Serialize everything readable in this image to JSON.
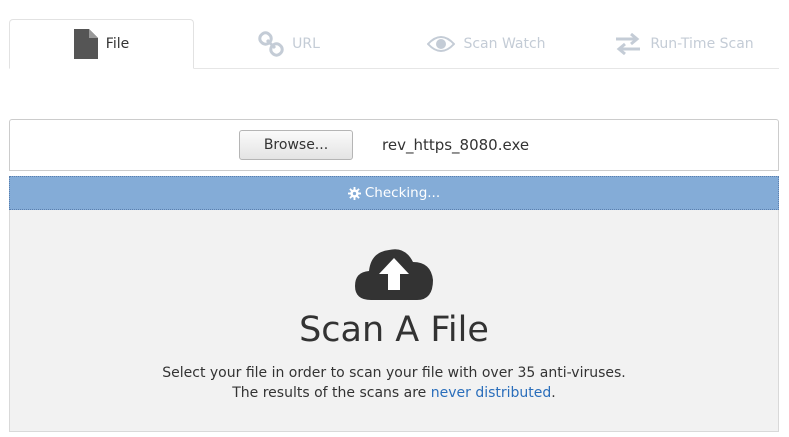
{
  "tabs": [
    {
      "label": "File",
      "icon": "file-icon",
      "active": true
    },
    {
      "label": "URL",
      "icon": "link-icon",
      "active": false
    },
    {
      "label": "Scan Watch",
      "icon": "eye-icon",
      "active": false
    },
    {
      "label": "Run-Time Scan",
      "icon": "exchange-arrows-icon",
      "active": false
    }
  ],
  "upload": {
    "browse_label": "Browse...",
    "file_name": "rev_https_8080.exe"
  },
  "progress": {
    "label": "Checking...",
    "icon": "gear-icon"
  },
  "main": {
    "icon": "cloud-upload-icon",
    "title": "Scan A File",
    "line1": "Select your file in order to scan your file with over 35 anti-viruses.",
    "line2_prefix": "The results of the scans are ",
    "line2_link": "never distributed",
    "line2_suffix": "."
  },
  "colors": {
    "progress_bar": "#84acd7",
    "link": "#2a6ebb",
    "inactive_tab": "#c4ccd6"
  }
}
